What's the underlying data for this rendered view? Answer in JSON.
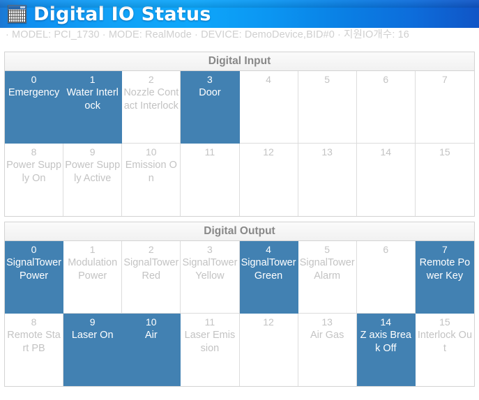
{
  "titlebar": {
    "title": "Digital IO Status",
    "icon": "grid-window-icon",
    "gradient_from": "#1b78d4",
    "gradient_mid": "#0ea7fb",
    "gradient_to": "#1055c6"
  },
  "subtitle": {
    "text": "· MODEL: PCI_1730  · MODE: RealMode  · DEVICE: DemoDevice,BID#0  · 지원IO개수: 16",
    "model_label": "MODEL",
    "model_value": "PCI_1730",
    "mode_label": "MODE",
    "mode_value": "RealMode",
    "device_label": "DEVICE",
    "device_value": "DemoDevice,BID#0",
    "io_count_label": "지원IO개수",
    "io_count_value": "16",
    "color": "#cfcfcf"
  },
  "colors": {
    "active_cell": "#4281b2",
    "inactive_text": "#c3c3c3",
    "active_text": "#ffffff",
    "panel_border": "#d3d3d3",
    "cell_border": "#dcdcdc",
    "section_header_text": "#888888"
  },
  "sections": [
    {
      "title": "Digital Input",
      "cells": [
        {
          "index": "0",
          "label": "Emergency",
          "state": "on"
        },
        {
          "index": "1",
          "label": "Water Interlock",
          "state": "on"
        },
        {
          "index": "2",
          "label": "Nozzle Contact Interlock",
          "state": "off"
        },
        {
          "index": "3",
          "label": "Door",
          "state": "on"
        },
        {
          "index": "4",
          "label": "",
          "state": "off"
        },
        {
          "index": "5",
          "label": "",
          "state": "off"
        },
        {
          "index": "6",
          "label": "",
          "state": "off"
        },
        {
          "index": "7",
          "label": "",
          "state": "off"
        },
        {
          "index": "8",
          "label": "Power Supply On",
          "state": "off"
        },
        {
          "index": "9",
          "label": "Power Supply Active",
          "state": "off"
        },
        {
          "index": "10",
          "label": "Emission On",
          "state": "off"
        },
        {
          "index": "11",
          "label": "",
          "state": "off"
        },
        {
          "index": "12",
          "label": "",
          "state": "off"
        },
        {
          "index": "13",
          "label": "",
          "state": "off"
        },
        {
          "index": "14",
          "label": "",
          "state": "off"
        },
        {
          "index": "15",
          "label": "",
          "state": "off"
        }
      ]
    },
    {
      "title": "Digital Output",
      "cells": [
        {
          "index": "0",
          "label": "SignalTower Power",
          "state": "on"
        },
        {
          "index": "1",
          "label": "Modulation Power",
          "state": "off"
        },
        {
          "index": "2",
          "label": "SignalTower Red",
          "state": "off"
        },
        {
          "index": "3",
          "label": "SignalTower Yellow",
          "state": "off"
        },
        {
          "index": "4",
          "label": "SignalTower Green",
          "state": "on"
        },
        {
          "index": "5",
          "label": "SignalTower Alarm",
          "state": "off"
        },
        {
          "index": "6",
          "label": "",
          "state": "off"
        },
        {
          "index": "7",
          "label": "Remote Power Key",
          "state": "on"
        },
        {
          "index": "8",
          "label": "Remote Start PB",
          "state": "off"
        },
        {
          "index": "9",
          "label": "Laser On",
          "state": "on"
        },
        {
          "index": "10",
          "label": "Air",
          "state": "on"
        },
        {
          "index": "11",
          "label": "Laser Emission",
          "state": "off"
        },
        {
          "index": "12",
          "label": "",
          "state": "off"
        },
        {
          "index": "13",
          "label": "Air Gas",
          "state": "off"
        },
        {
          "index": "14",
          "label": "Z axis Break Off",
          "state": "on"
        },
        {
          "index": "15",
          "label": "Interlock Out",
          "state": "off"
        }
      ]
    }
  ]
}
